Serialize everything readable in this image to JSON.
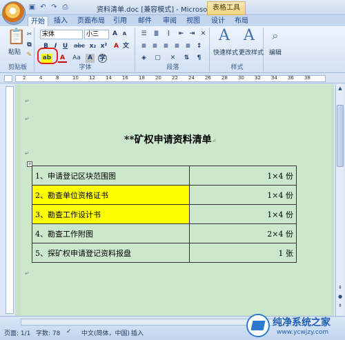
{
  "window": {
    "title": "资料清单.doc [兼容模式] - Microsoft ...",
    "tool_title": "表格工具"
  },
  "qat": {
    "icons": [
      "save-icon",
      "undo-icon",
      "redo-icon",
      "print-icon"
    ]
  },
  "tabs": [
    "开始",
    "插入",
    "页面布局",
    "引用",
    "邮件",
    "审阅",
    "视图",
    "设计",
    "布局"
  ],
  "ribbon": {
    "clipboard": {
      "paste_label": "粘贴",
      "group_label": "剪贴板"
    },
    "font": {
      "font_name": "宋体",
      "font_size": "小三",
      "group_label": "字体",
      "bold": "B",
      "italic": "I",
      "underline": "U",
      "strike": "abc",
      "subscript": "x₂",
      "superscript": "x²",
      "grow": "A",
      "shrink": "A",
      "aa": "Aa",
      "clear": "A",
      "phonetic": "文",
      "charborder": "A"
    },
    "paragraph": {
      "group_label": "段落"
    },
    "styles": {
      "quick_styles": "快速样式",
      "change_styles": "更改样式",
      "group_label": "样式"
    },
    "editing": {
      "label": "编辑"
    }
  },
  "ruler": {
    "numbers": [
      "2",
      "4",
      "8",
      "10",
      "12",
      "14",
      "16",
      "18",
      "20",
      "22",
      "24",
      "26",
      "28",
      "30",
      "32",
      "34",
      "36",
      "38"
    ]
  },
  "document": {
    "title": "**矿权申请资料清单",
    "rows": [
      {
        "name": "1、申请登记区块范围图",
        "qty": "1×4 份",
        "highlight": false
      },
      {
        "name": "2、勘查单位资格证书",
        "qty": "1×4 份",
        "highlight": true
      },
      {
        "name": "3、勘查工作设计书",
        "qty": "1×4 份",
        "highlight": true
      },
      {
        "name": "4、勘查工作附图",
        "qty": "2×4 份",
        "highlight": false
      },
      {
        "name": "5、探矿权申请登记资料报盘",
        "qty": "1 张",
        "highlight": false
      }
    ],
    "highlight_color": "#ffff00"
  },
  "status": {
    "page": "页面: 1/1",
    "words": "字数: 78",
    "language": "中文(简体，中国)",
    "mode": "插入"
  },
  "watermark": {
    "title": "纯净系统之家",
    "url": "www.ycwjzy.com"
  }
}
